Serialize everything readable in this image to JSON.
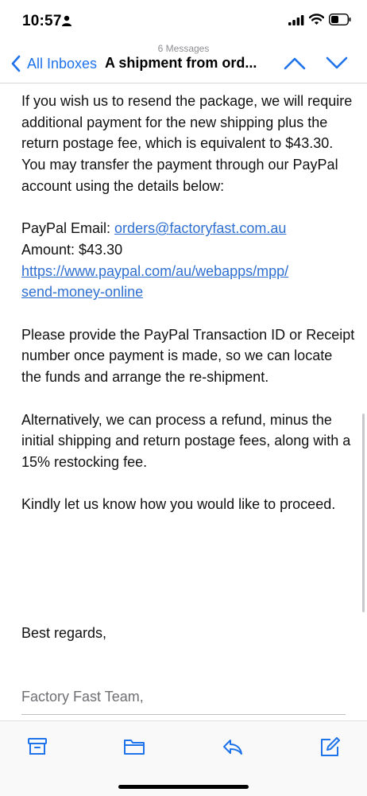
{
  "status": {
    "time": "10:57"
  },
  "nav": {
    "message_count": "6 Messages",
    "back_label": "All Inboxes",
    "subject": "A shipment from ord..."
  },
  "body": {
    "p1": "If you wish us to resend the package, we will require additional payment for the new shipping plus the return postage fee, which is equivalent to $43.30. You may transfer the payment through our PayPal account using the details below:",
    "paypal_email_label": "PayPal Email: ",
    "paypal_email": "orders@factoryfast.com.au",
    "amount": "Amount: $43.30",
    "paypal_link_1": "https://www.paypal.com/au/webapps/mpp/",
    "paypal_link_2": "send-money-online",
    "p3": "Please provide the PayPal Transaction ID or Receipt number once payment is made, so we can locate the funds and arrange the re-shipment.",
    "p4": "Alternatively, we can process a refund, minus the initial shipping and return postage fees, along with a 15% restocking fee.",
    "p5": "Kindly let us know how you would like to proceed.",
    "signoff": "Best regards,",
    "team": "Factory Fast Team,"
  },
  "colors": {
    "accent": "#1e72ea",
    "link": "#2f6fd1"
  },
  "toolbar": {
    "icons": [
      "archive-icon",
      "folder-icon",
      "reply-icon",
      "compose-icon"
    ]
  }
}
